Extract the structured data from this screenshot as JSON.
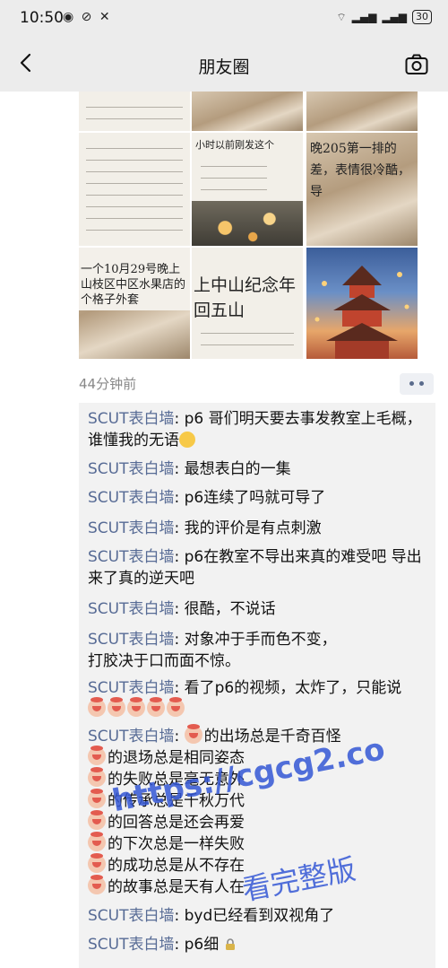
{
  "status_bar": {
    "time": "10:50",
    "battery": "30"
  },
  "nav": {
    "title": "朋友圈"
  },
  "images": {
    "tile_1_text": "小时以前刚发这个",
    "tile_2_text": "晚205第一排的差，表情很冷酷，导",
    "tile_3_text": "一个10月29号晚上山枝区中区水果店的个格子外套",
    "tile_4_text": "上中山纪念年回五山"
  },
  "post": {
    "time_ago": "44分钟前"
  },
  "comments": [
    {
      "name": "SCUT表白墙",
      "text": "p6 哥们明天要去事发教室上毛概，谁懂我的无语"
    },
    {
      "name": "SCUT表白墙",
      "text": "最想表白的一集"
    },
    {
      "name": "SCUT表白墙",
      "text": "p6连续了吗就可导了"
    },
    {
      "name": "SCUT表白墙",
      "text": "我的评价是有点刺激"
    },
    {
      "name": "SCUT表白墙",
      "text": "p6在教室不导出来真的难受吧 导出来了真的逆天吧"
    },
    {
      "name": "SCUT表白墙",
      "text": "很酷，不说话"
    },
    {
      "name": "SCUT表白墙",
      "line1": "对象冲于手而色不变，",
      "line2": "打胶决于口而面不惊。"
    },
    {
      "name": "SCUT表白墙",
      "text": "看了p6的视频，太炸了，只能说"
    },
    {
      "name": "SCUT表白墙",
      "lines": [
        "的出场总是千奇百怪",
        "的退场总是相同姿态",
        "的失败总是毫无意外",
        "的传承总是千秋万代",
        "的回答总是还会再爱",
        "的下次总是一样失败",
        "的成功总是从不存在",
        "的故事总是天有人在"
      ]
    },
    {
      "name": "SCUT表白墙",
      "text": "byd已经看到双视角了"
    },
    {
      "name": "SCUT表白墙",
      "text": "p6细"
    }
  ],
  "watermark": {
    "url": "https://cgcg2.co",
    "text": "看完整版"
  }
}
